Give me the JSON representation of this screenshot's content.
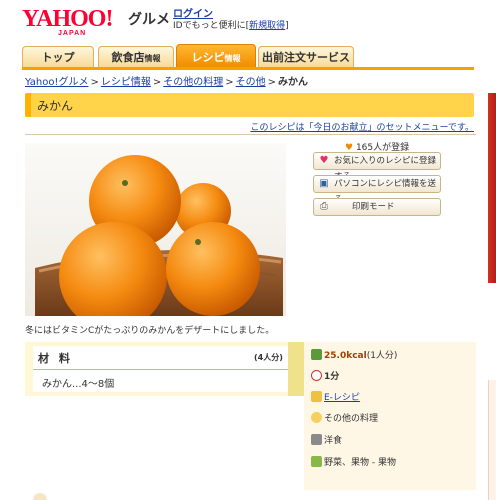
{
  "header": {
    "logo_text": "YAHOO!",
    "logo_sub": "JAPAN",
    "section": "グルメ",
    "login_link": "ログイン",
    "login_note": "IDでもっと便利に[",
    "register_link": "新規取得",
    "register_close": "]"
  },
  "tabs": [
    {
      "label": "トップ",
      "sub": ""
    },
    {
      "label": "飲食店",
      "sub": "情報"
    },
    {
      "label": "レシピ",
      "sub": "情報"
    },
    {
      "label": "出前注文サービス",
      "sub": ""
    }
  ],
  "breadcrumb": [
    "Yahoo!グルメ",
    "レシピ情報",
    "その他の料理",
    "その他"
  ],
  "breadcrumb_sep": ">",
  "breadcrumb_current": "みかん",
  "title": "みかん",
  "set_menu_link": "このレシピは「今日のお献立」のセットメニューです。",
  "caption": "冬にはビタミンCがたっぷりのみかんをデザートにしました。",
  "registered": "165人が登録",
  "actions": {
    "favorite": "お気に入りのレシピに登録する",
    "send_pc": "パソコンにレシピ情報を送る",
    "print": "印刷モード"
  },
  "ingredients": {
    "title": "材 料",
    "servings": "(4人分)",
    "items": [
      "みかん...4～8個"
    ]
  },
  "info": {
    "calories": "25.0kcal",
    "calories_unit": "(1人分)",
    "time": "1分",
    "difficulty": "E-レシピ",
    "category": "その他の料理",
    "cuisine": "洋食",
    "ingredient_type": "野菜、果物 - 果物"
  },
  "colors": {
    "brand_red": "#ff0033",
    "tab_orange": "#f7a000",
    "title_yellow": "#ffd34a",
    "link_blue": "#1a3ea6"
  }
}
